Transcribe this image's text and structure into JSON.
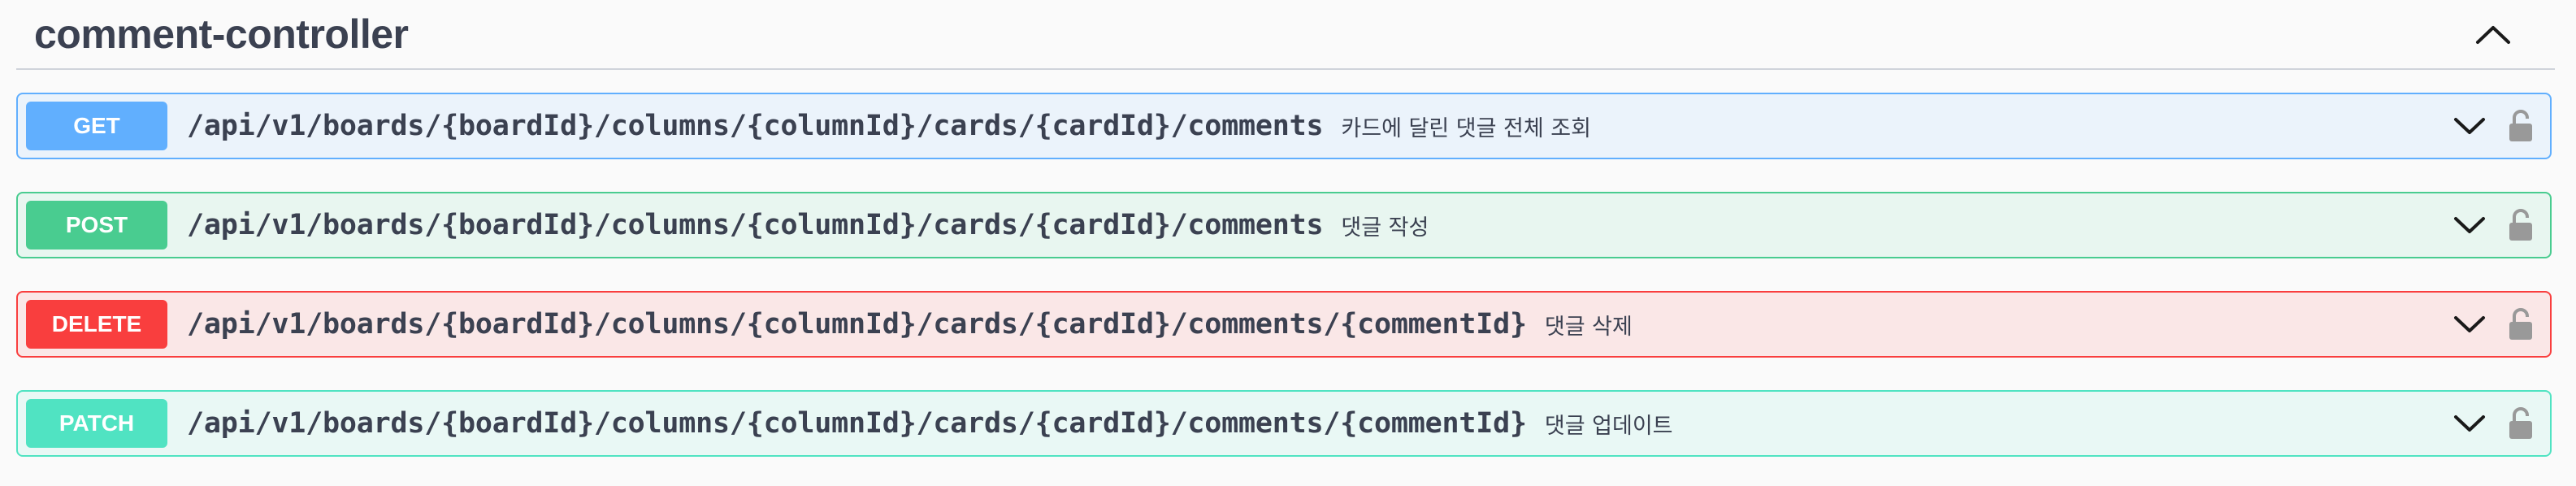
{
  "controller": {
    "title": "comment-controller",
    "toggle_icon": "chevron-up-icon"
  },
  "operations": [
    {
      "method": "GET",
      "path": "/api/v1/boards/{boardId}/columns/{columnId}/cards/{cardId}/comments",
      "summary": "카드에 달린 댓글 전체 조회",
      "color": "#61affe"
    },
    {
      "method": "POST",
      "path": "/api/v1/boards/{boardId}/columns/{columnId}/cards/{cardId}/comments",
      "summary": "댓글 작성",
      "color": "#49cc90"
    },
    {
      "method": "DELETE",
      "path": "/api/v1/boards/{boardId}/columns/{columnId}/cards/{cardId}/comments/{commentId}",
      "summary": "댓글 삭제",
      "color": "#f93e3e"
    },
    {
      "method": "PATCH",
      "path": "/api/v1/boards/{boardId}/columns/{columnId}/cards/{cardId}/comments/{commentId}",
      "summary": "댓글 업데이트",
      "color": "#50e3c2"
    }
  ],
  "icons": {
    "expand": "chevron-down-icon",
    "auth": "lock-icon"
  }
}
